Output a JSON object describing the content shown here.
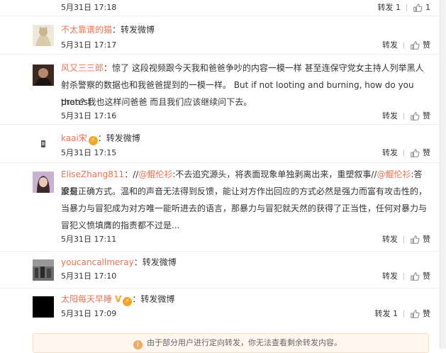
{
  "rows": [
    {
      "date": "5月31日 17:18",
      "forward": "转发 1",
      "like": "1"
    },
    {
      "user": "不太靠谱的猫",
      "sep": "：",
      "text": "转发微博",
      "date": "5月31日 17:17",
      "forward": "转发",
      "like": "赞"
    },
    {
      "user": "风又三三郎",
      "sep": "：",
      "text_line1": "惊了 这段视频跟今天我和爸爸争吵的内容一模一样 甚至连保守党女主持人列举黑人",
      "text_line2": "射杀警察的数据也和我爸爸提到的一模一样。 But if not looting and burning, how do you protest",
      "text_line3": "then? 我也这样问爸爸 而且我们应该继续问下去。",
      "date": "5月31日 17:16",
      "forward": "转发",
      "like": "赞"
    },
    {
      "user": "kaai宋",
      "sep": "：",
      "text": "转发微博",
      "date": "5月31日 17:15",
      "forward": "转发",
      "like": "赞"
    },
    {
      "user": "EliseZhang811",
      "sep": "：",
      "slash1": "//",
      "mention1": "@鲲伦衫",
      "text_a": ":不去追究源头，将表面现象单独剥离出来，重塑叙事",
      "slash2": "//",
      "mention2": "@鲲伦衫",
      "text_b": ":答案是",
      "text_line2": "没有正确方式。温和的声音无法得到反馈，能让对方作出回应的方式必然是强力而富有攻击性的，",
      "text_line3": "当暴力与冒犯成为对方唯一能听进去的语言，那暴力与冒犯就天然的获得了正当性，任何对暴力与",
      "text_line4": "冒犯义愤填膺的指责都不过是...",
      "date": "5月31日 17:11",
      "forward": "转发",
      "like": "赞"
    },
    {
      "user": "youcancallmeray",
      "sep": "：",
      "text": "转发微博",
      "date": "5月31日 17:10",
      "forward": "转发",
      "like": "赞"
    },
    {
      "user": "太阳每天早睡",
      "vip": "V",
      "sep": "：",
      "text": "转发微博",
      "date": "5月31日 17:09",
      "forward": "转发 1",
      "like": "赞"
    }
  ],
  "notice": "由于部分用户进行定向转发，你无法查看剩余转发内容。",
  "colors": {
    "accent": "#eb7350",
    "notice_bg": "#fff7ed"
  }
}
